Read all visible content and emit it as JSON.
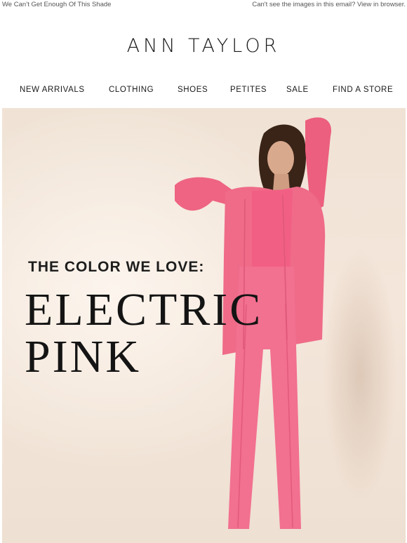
{
  "preheader": {
    "subject": "We Can’t Get Enough Of This Shade",
    "view_in_browser": "Can't see the images in this email? View in browser."
  },
  "brand": {
    "logo_text": "ANN TAYLOR"
  },
  "nav": {
    "items": [
      {
        "label": "NEW ARRIVALS"
      },
      {
        "label": "CLOTHING"
      },
      {
        "label": "SHOES"
      },
      {
        "label": "PETITES"
      },
      {
        "label": "SALE"
      },
      {
        "label": "FIND A STORE"
      }
    ]
  },
  "hero": {
    "tagline": "THE COLOR WE LOVE:",
    "headline_line1": "ELECTRIC",
    "headline_line2": "PINK",
    "image": "model-in-pink-cardigan-and-pants",
    "colors": {
      "background": "#f2e4d7",
      "pink": "#f06b86",
      "text": "#141414"
    }
  }
}
